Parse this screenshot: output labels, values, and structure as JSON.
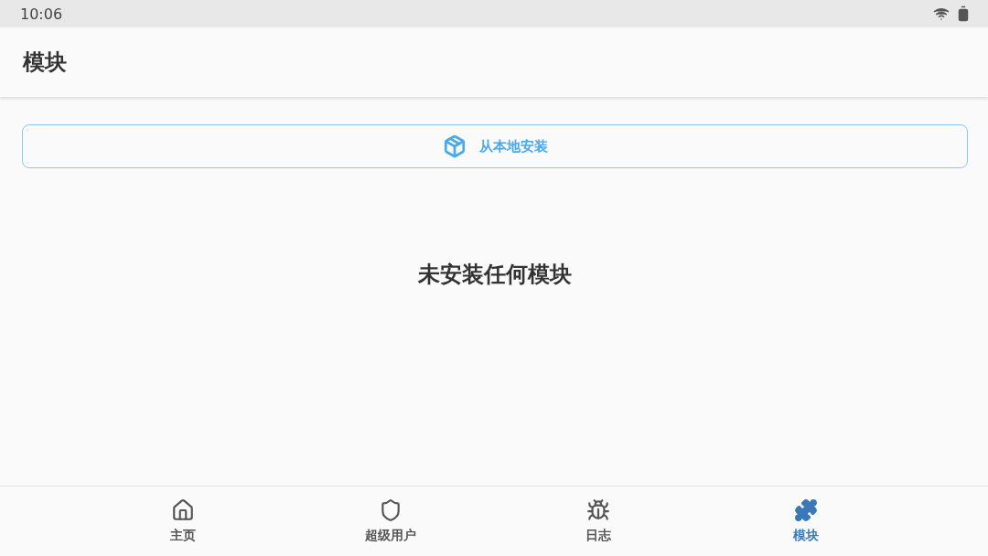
{
  "status_bar": {
    "time": "10:06"
  },
  "app_bar": {
    "title": "模块"
  },
  "install_button": {
    "label": "从本地安装"
  },
  "empty_message": "未安装任何模块",
  "bottom_nav": [
    {
      "kind": "home",
      "label": "主页",
      "selected": false
    },
    {
      "kind": "shield",
      "label": "超级用户",
      "selected": false
    },
    {
      "kind": "bug",
      "label": "日志",
      "selected": false
    },
    {
      "kind": "puzzle",
      "label": "模块",
      "selected": true
    }
  ]
}
